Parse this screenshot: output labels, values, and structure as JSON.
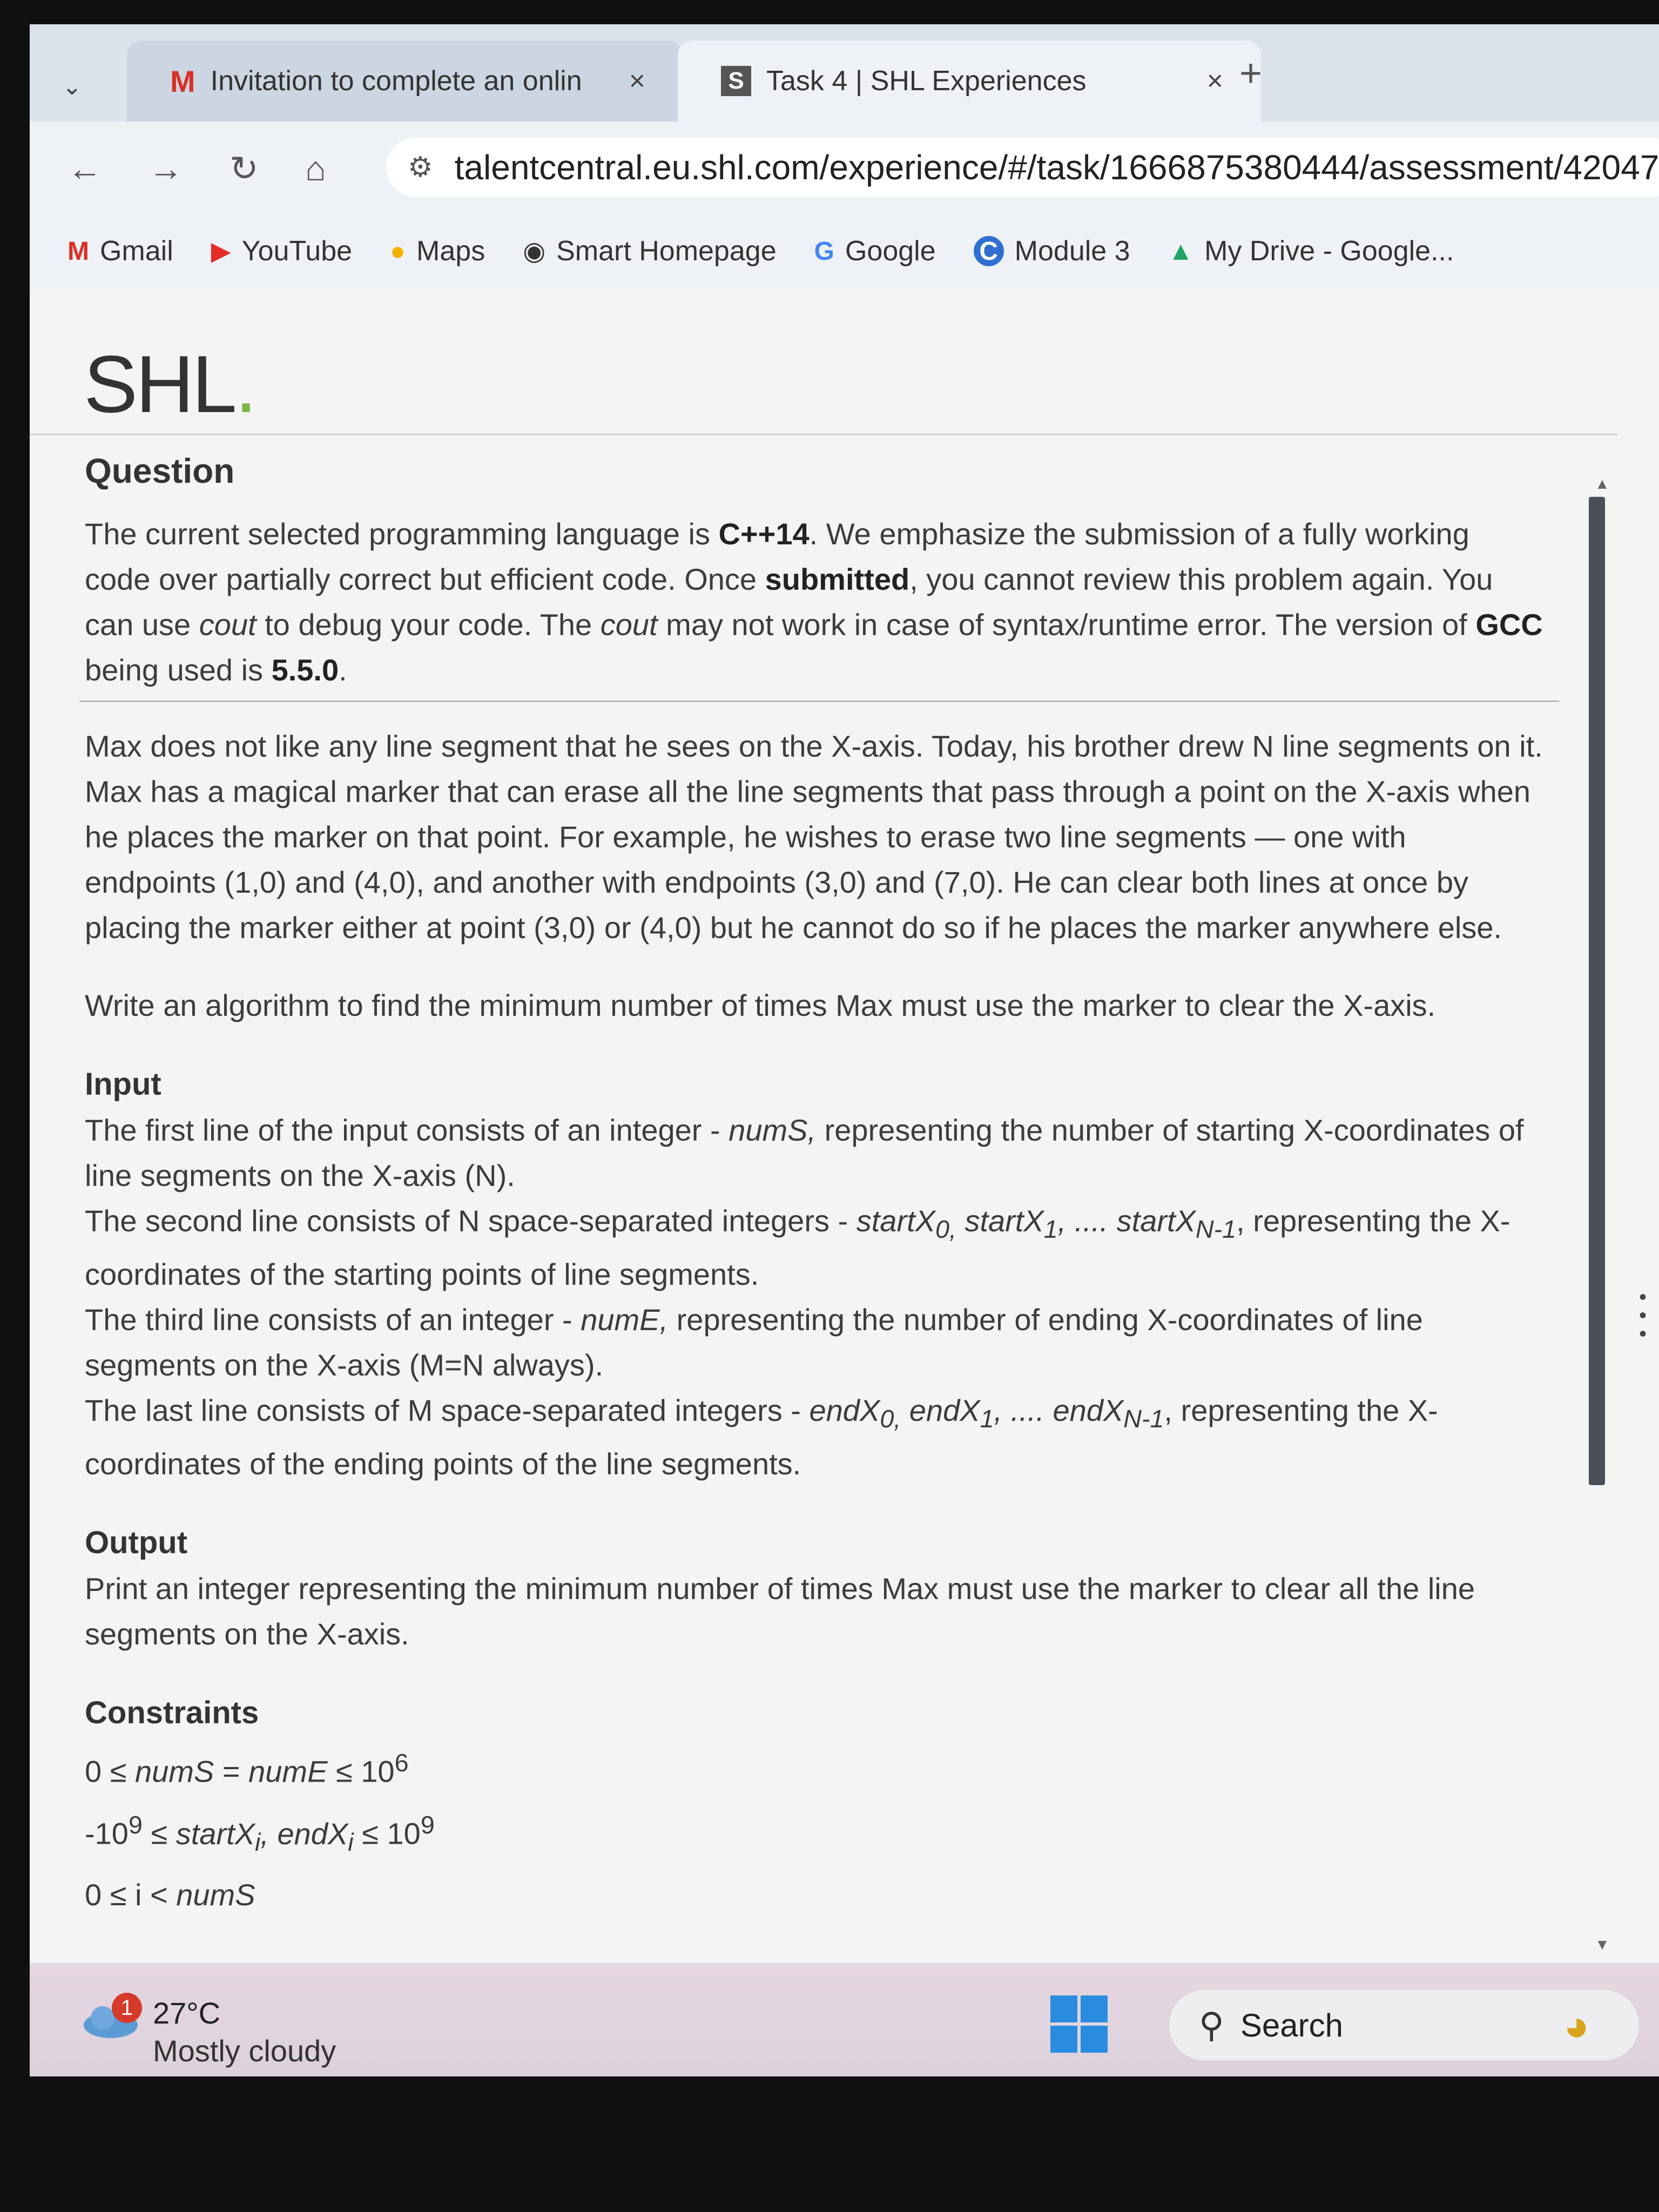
{
  "browser": {
    "tabs": [
      {
        "label": "Invitation to complete an onlin",
        "icon": "gmail-icon"
      },
      {
        "label": "Task 4 | SHL Experiences",
        "icon": "shl-favicon"
      }
    ],
    "close_glyph": "×",
    "new_tab_glyph": "+",
    "address": "talentcentral.eu.shl.com/experience/#/task/1666875380444/assessment/42047",
    "bookmarks": [
      {
        "label": "Gmail",
        "icon": "gmail-icon"
      },
      {
        "label": "YouTube",
        "icon": "youtube-icon"
      },
      {
        "label": "Maps",
        "icon": "maps-pin-icon"
      },
      {
        "label": "Smart Homepage",
        "icon": "smart-homepage-icon"
      },
      {
        "label": "Google",
        "icon": "google-icon"
      },
      {
        "label": "Module 3",
        "icon": "module-icon"
      },
      {
        "label": "My Drive - Google...",
        "icon": "drive-icon"
      }
    ]
  },
  "page": {
    "logo": "SHL",
    "question_heading": "Question",
    "lang_note": {
      "p1": "The current selected programming language is ",
      "lang": "C++14",
      "p2": ". We emphasize the submission of a fully working code over partially correct but efficient code. Once ",
      "submitted": "submitted",
      "p3": ", you cannot review this problem again. You can use ",
      "cout1": "cout",
      "p4": " to debug your code.  The ",
      "cout2": "cout",
      "p5": " may not work in case of syntax/runtime error. The version of ",
      "gcc": "GCC",
      "p6": " being used is ",
      "version": "5.5.0",
      "p7": "."
    },
    "problem_text": "Max does not like any line segment that he sees on the X-axis. Today, his brother drew N line segments on it. Max has a magical marker that can erase all the line segments that pass through a point on the X-axis when he places the marker on that point. For example, he wishes to erase two line segments — one with endpoints (1,0) and (4,0), and another with endpoints (3,0) and (7,0). He can clear both lines at once by placing the marker either at point (3,0) or (4,0) but he cannot do so if he places the marker anywhere else.",
    "task_text": "Write an algorithm to find the minimum number of times Max must use the marker to clear the X-axis.",
    "input_heading": "Input",
    "input": {
      "l1a": "The first line of the input consists of an integer - ",
      "l1var": "numS,",
      "l1b": " representing the number of starting  X-coordinates of line segments on the X-axis (N).",
      "l2a": "The second line consists of N space-separated integers - ",
      "l2v1": "startX",
      "l2s1": "0,",
      "l2v2": " startX",
      "l2s2": "1",
      "l2v3": ", .... startX",
      "l2s3": "N-1",
      "l2b": ", representing the X-coordinates of the starting points of line segments.",
      "l3a": "The third line consists of an integer - ",
      "l3var": "numE,",
      "l3b": " representing the number of ending  X-coordinates of line segments on the X-axis (M=N always).",
      "l4a": "The last line consists of M space-separated integers - ",
      "l4v1": "endX",
      "l4s1": "0,",
      "l4v2": " endX",
      "l4s2": "1",
      "l4v3": ", .... endX",
      "l4s3": "N-1",
      "l4b": ", representing the X-coordinates of the ending points of the line segments."
    },
    "output_heading": "Output",
    "output_text": "Print an integer representing the minimum number of times Max must use the marker to clear all the line segments on the X-axis.",
    "constraints_heading": "Constraints",
    "constraints": {
      "c1a": "0 ≤ ",
      "c1b": "numS",
      "c1c": " = ",
      "c1d": "numE",
      "c1e": " ≤ 10",
      "c1exp": "6",
      "c2a": "-10",
      "c2exp1": "9",
      "c2b": " ≤ ",
      "c2c": "startX",
      "c2sub1": "i",
      "c2d": ", endX",
      "c2sub2": "i",
      "c2e": " ≤ 10",
      "c2exp2": "9",
      "c3a": "0 ≤ i < ",
      "c3b": "numS"
    }
  },
  "taskbar": {
    "weather_badge": "1",
    "temperature": "27°C",
    "condition": "Mostly cloudy",
    "search_label": "Search"
  },
  "colors": {
    "shl_dot": "#7bb742",
    "windows_blue": "#2a8ce0",
    "gmail_red": "#d93025"
  }
}
